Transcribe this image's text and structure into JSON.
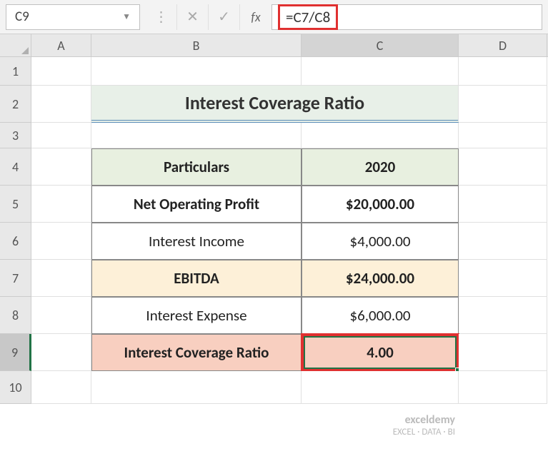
{
  "nameBox": "C9",
  "formula": "=C7/C8",
  "columns": [
    "A",
    "B",
    "C",
    "D"
  ],
  "activeColumn": "C",
  "activeRow": "9",
  "title": "Interest Coverage Ratio",
  "table": {
    "headerParticulars": "Particulars",
    "headerYear": "2020",
    "rows": [
      {
        "label": "Net Operating Profit",
        "value": "$20,000.00",
        "bold": true,
        "class": ""
      },
      {
        "label": "Interest Income",
        "value": "$4,000.00",
        "bold": false,
        "class": ""
      },
      {
        "label": "EBITDA",
        "value": "$24,000.00",
        "bold": true,
        "class": "ebitda-row"
      },
      {
        "label": "Interest Expense",
        "value": "$6,000.00",
        "bold": false,
        "class": ""
      },
      {
        "label": "Interest Coverage Ratio",
        "value": "4.00",
        "bold": true,
        "class": "icr-row"
      }
    ]
  },
  "watermark": {
    "brand": "exceldemy",
    "tag": "EXCEL · DATA · BI"
  }
}
